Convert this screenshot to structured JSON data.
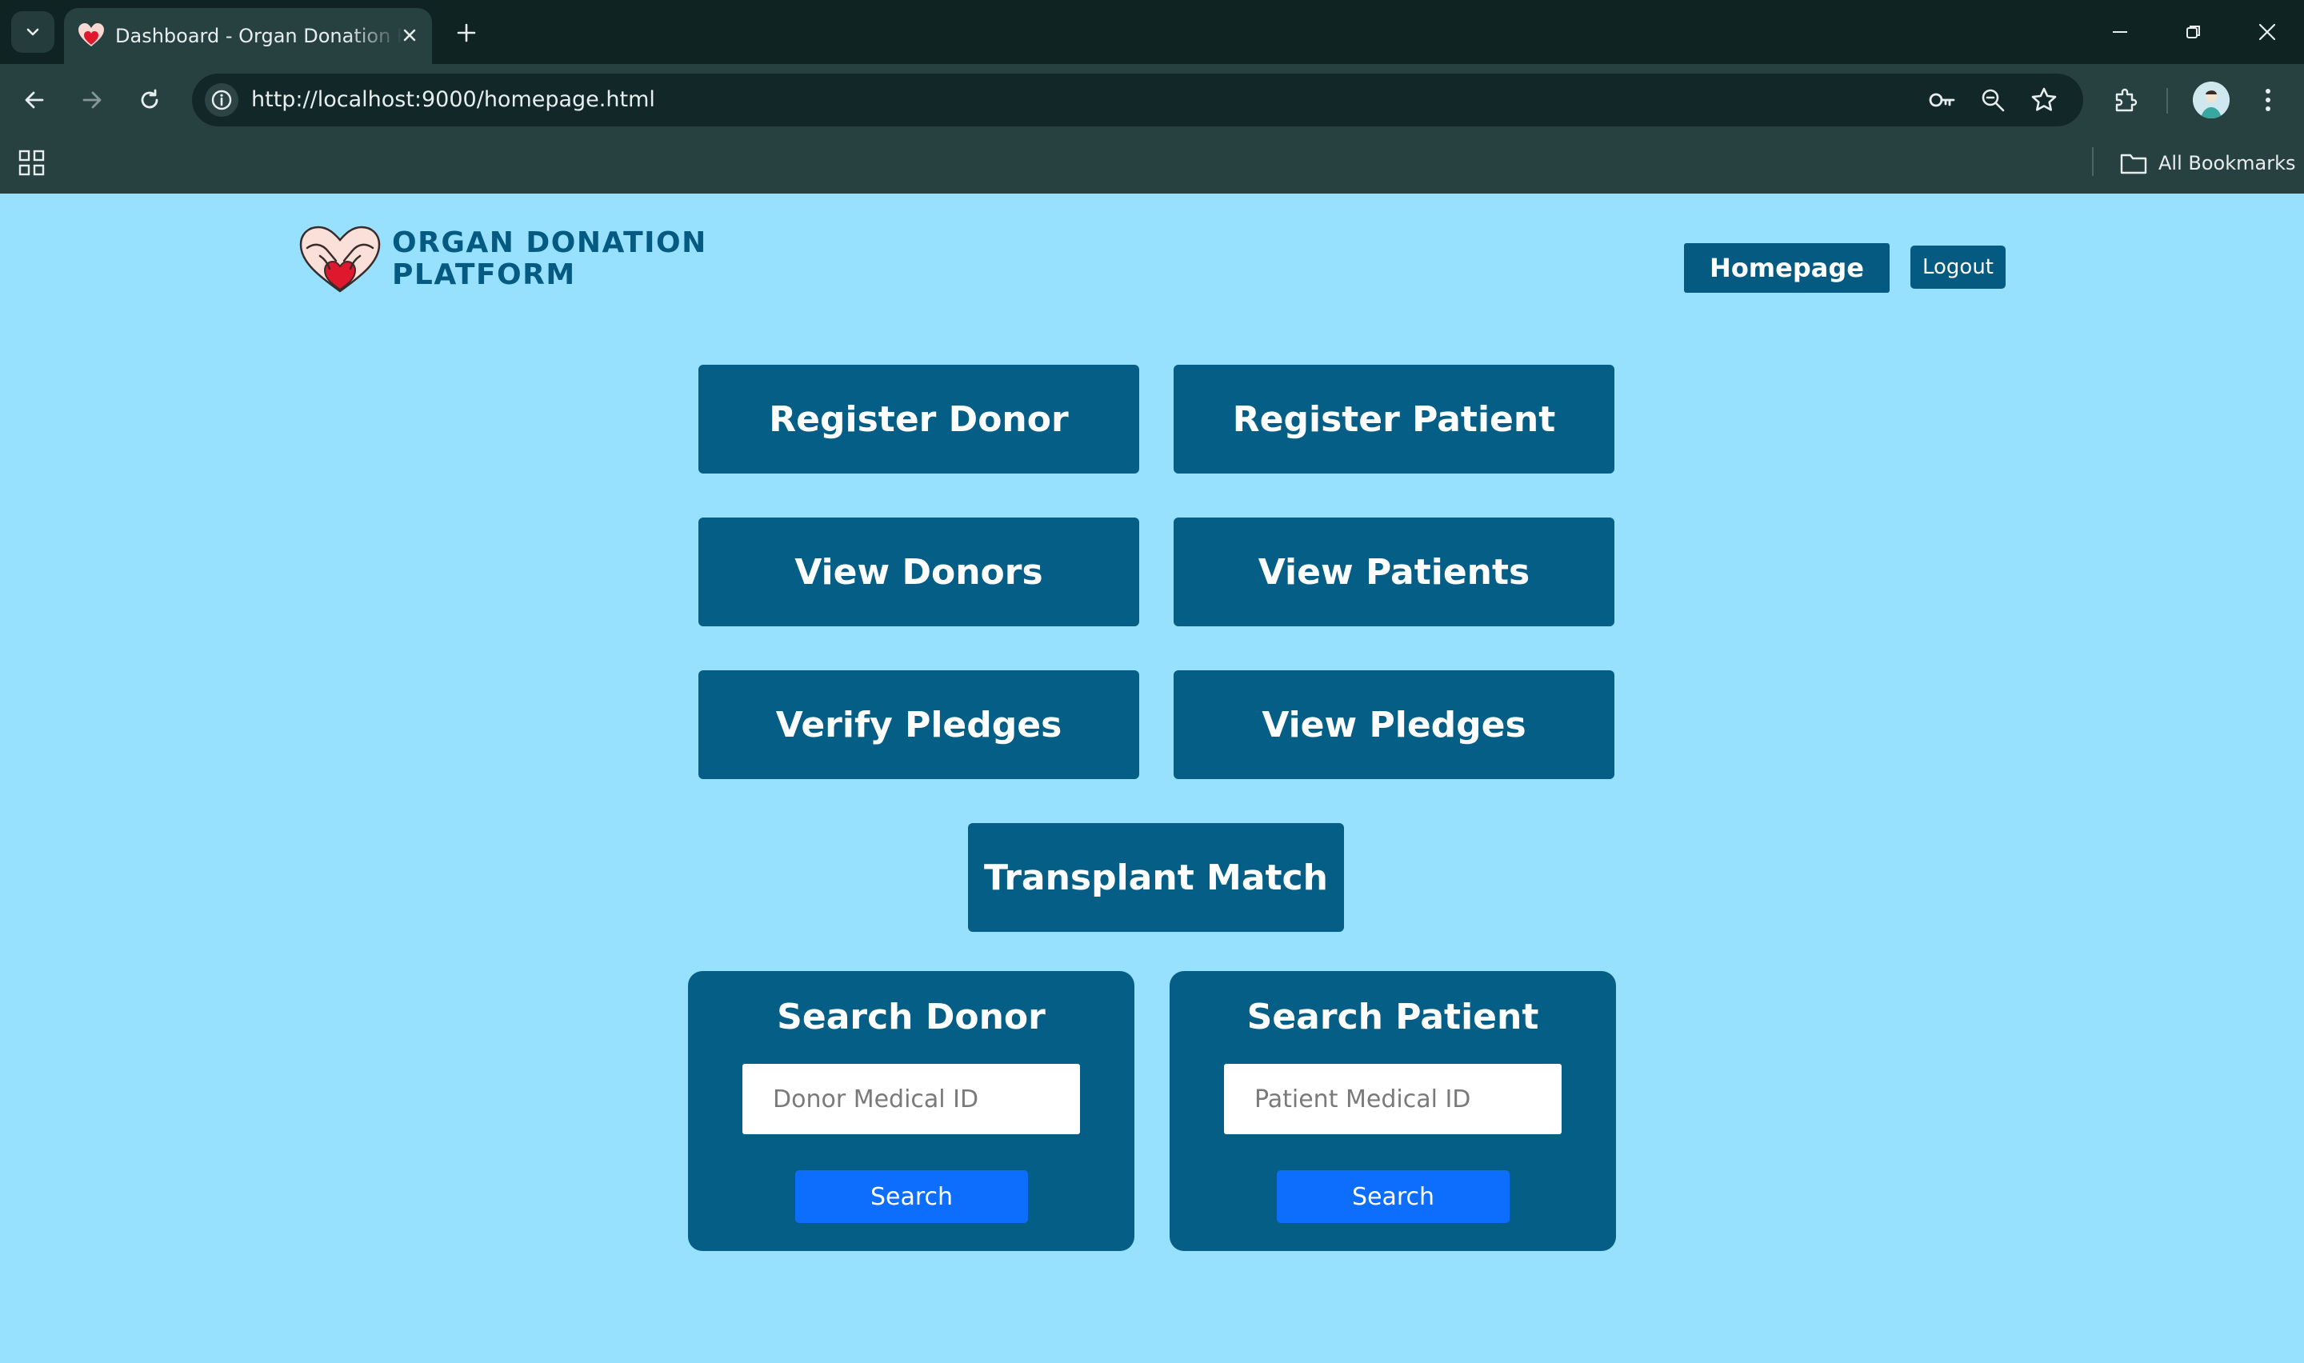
{
  "browser": {
    "tab_title": "Dashboard - Organ Donation Platform",
    "url": "http://localhost:9000/homepage.html",
    "bookmarks_label": "All Bookmarks",
    "icons": [
      "tab-search-icon",
      "heart-favicon-icon",
      "close-icon",
      "plus-icon",
      "minimize-icon",
      "restore-icon",
      "window-close-icon",
      "back-arrow-icon",
      "forward-arrow-icon",
      "reload-icon",
      "info-icon",
      "key-icon",
      "zoom-icon",
      "star-icon",
      "extensions-icon",
      "avatar",
      "more-vert-icon",
      "apps-grid-icon",
      "folder-icon"
    ]
  },
  "header": {
    "brand_line1": "ORGAN DONATION",
    "brand_line2": "PLATFORM",
    "nav_homepage": "Homepage",
    "nav_logout": "Logout"
  },
  "actions": {
    "register_donor": "Register Donor",
    "register_patient": "Register Patient",
    "view_donors": "View Donors",
    "view_patients": "View Patients",
    "verify_pledges": "Verify Pledges",
    "view_pledges": "View Pledges",
    "transplant_match": "Transplant Match"
  },
  "search_donor": {
    "title": "Search Donor",
    "placeholder": "Donor Medical ID",
    "value": "",
    "button": "Search"
  },
  "search_patient": {
    "title": "Search Patient",
    "placeholder": "Patient Medical ID",
    "value": "",
    "button": "Search"
  },
  "colors": {
    "page_background": "#97e0fe",
    "primary": "#045e85",
    "search_button": "#0d6efd",
    "browser_frame": "#0f2323",
    "browser_toolbar": "#274040"
  }
}
